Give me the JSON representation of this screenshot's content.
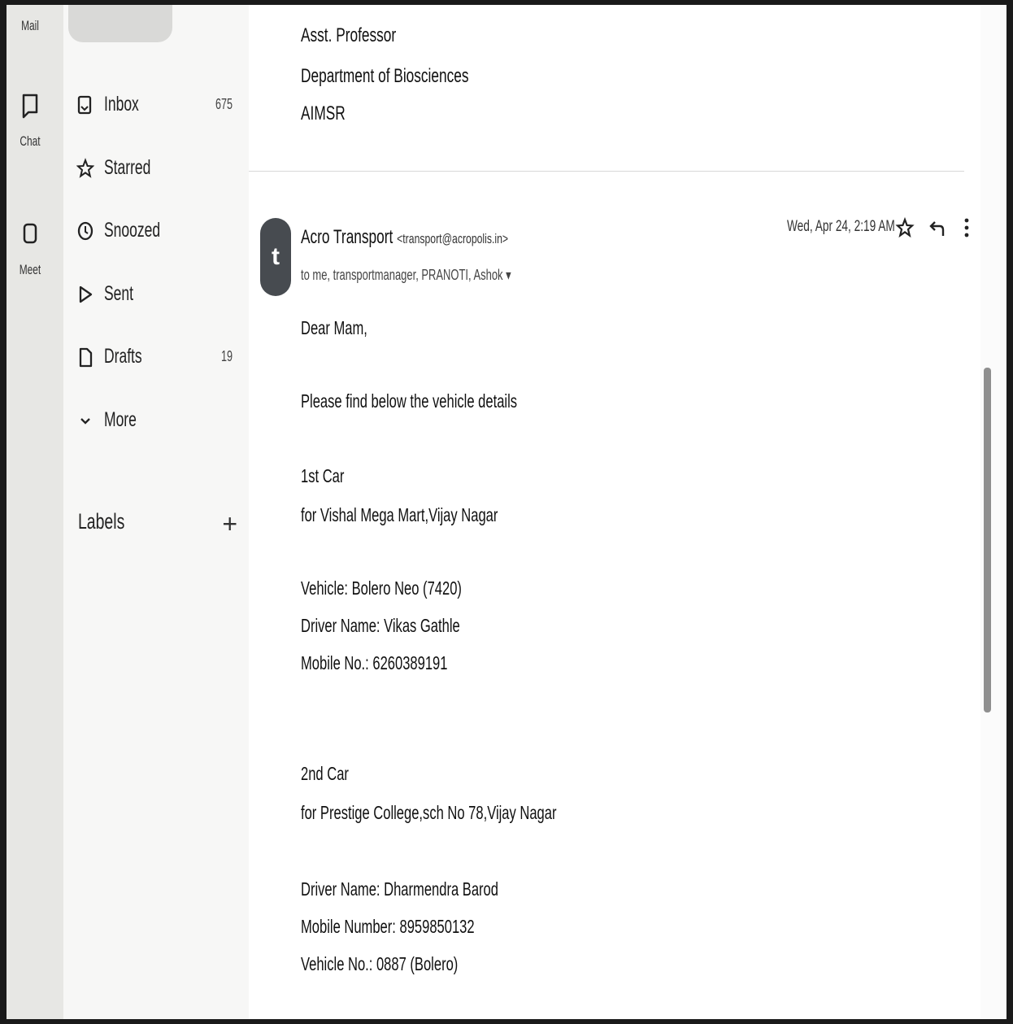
{
  "rail": {
    "mail_label": "Mail",
    "chat_label": "Chat",
    "meet_label": "Meet"
  },
  "nav": {
    "items": [
      {
        "label": "Inbox",
        "count": "675",
        "icon": "inbox-icon"
      },
      {
        "label": "Starred",
        "count": "",
        "icon": "star-icon"
      },
      {
        "label": "Snoozed",
        "count": "",
        "icon": "clock-icon"
      },
      {
        "label": "Sent",
        "count": "",
        "icon": "send-icon"
      },
      {
        "label": "Drafts",
        "count": "19",
        "icon": "draft-icon"
      },
      {
        "label": "More",
        "count": "",
        "icon": "chevron-down-icon"
      }
    ],
    "labels_heading": "Labels",
    "labels_add": "+"
  },
  "prev_message": {
    "signature": [
      "Asst. Professor",
      "Department of Biosciences",
      "AIMSR"
    ]
  },
  "message": {
    "avatar_letter": "t",
    "sender_name": "Acro Transport",
    "sender_email": "<transport@acropolis.in>",
    "recipients": "to me, transportmanager, PRANOTI, Ashok",
    "recipients_caret": "▾",
    "date": "Wed, Apr 24, 2:19 AM",
    "body": [
      "Dear Mam,",
      "Please find below the vehicle details",
      "1st Car",
      "for Vishal Mega Mart,Vijay Nagar",
      "Vehicle: Bolero Neo (7420)",
      "Driver Name: Vikas Gathle",
      "Mobile No.: 6260389191",
      "2nd Car",
      "for Prestige College,sch No 78,Vijay Nagar",
      "Driver Name: Dharmendra Barod",
      "Mobile Number: 8959850132",
      "Vehicle No.: 0887 (Bolero)"
    ]
  }
}
